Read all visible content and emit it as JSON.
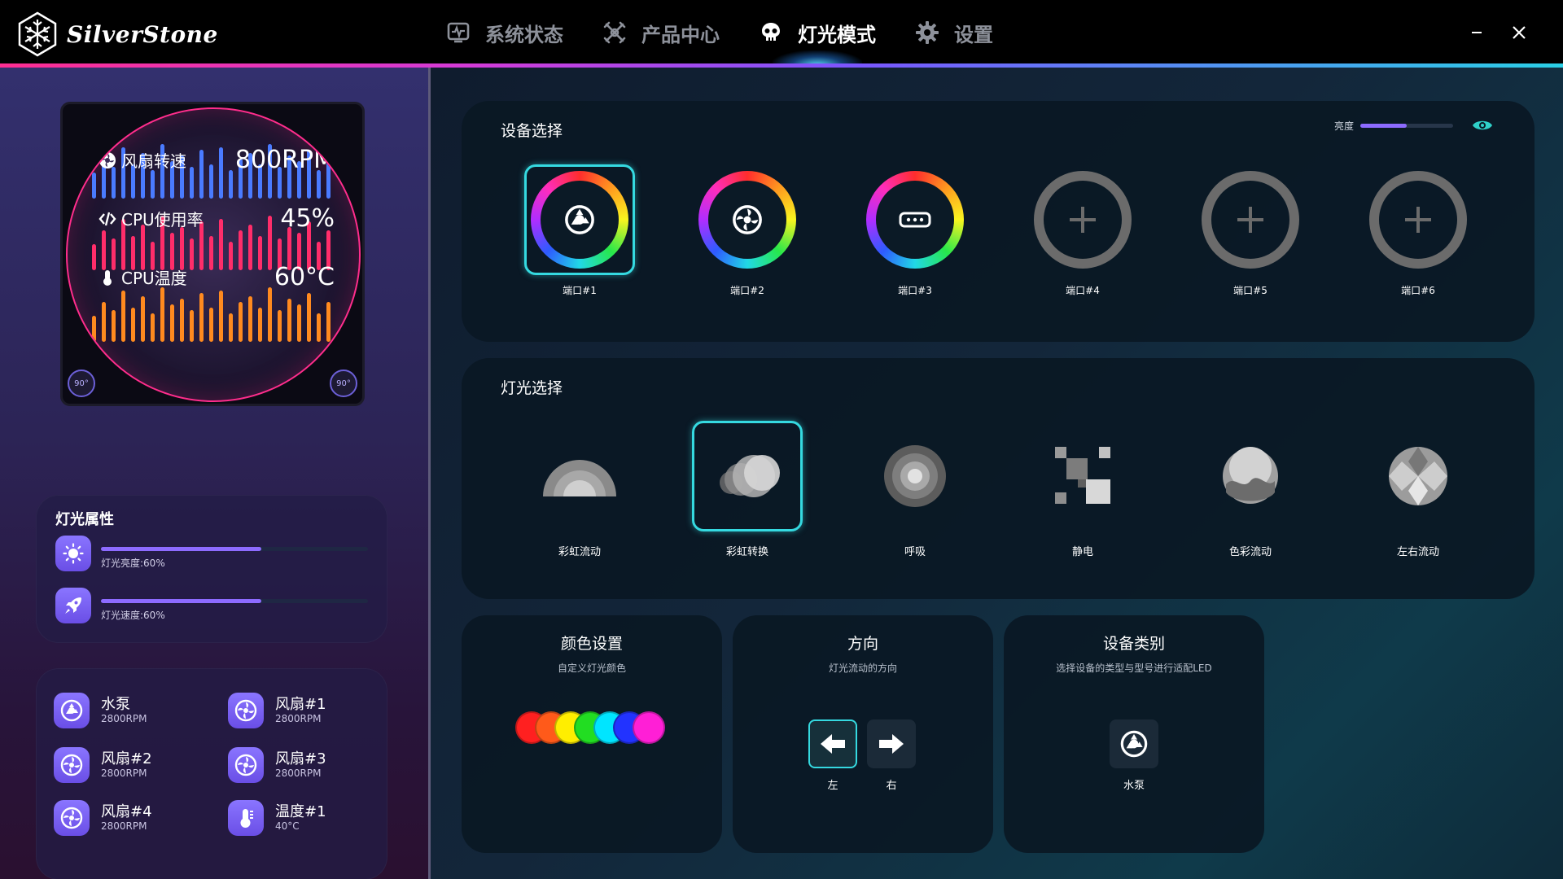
{
  "app": {
    "logo_text": "SilverStone"
  },
  "nav": {
    "tabs": [
      {
        "label": "系统状态",
        "icon": "monitor-icon",
        "active": false
      },
      {
        "label": "产品中心",
        "icon": "fan-crossed-icon",
        "active": false
      },
      {
        "label": "灯光模式",
        "icon": "skull-icon",
        "active": true
      },
      {
        "label": "设置",
        "icon": "gear-icon",
        "active": false
      }
    ]
  },
  "lcd": {
    "rows": [
      {
        "label": "风扇转速",
        "value": "800RPM",
        "icon": "fan-icon"
      },
      {
        "label": "CPU使用率",
        "value": "45%",
        "icon": "code-icon"
      },
      {
        "label": "CPU温度",
        "value": "60°C",
        "icon": "thermometer-icon"
      }
    ],
    "rotate_left": "90°",
    "rotate_right": "90°",
    "colors": {
      "blue": "#4a7bff",
      "red": "#ff2d6a",
      "orange": "#ff8a1f"
    }
  },
  "light_props": {
    "title": "灯光属性",
    "brightness": {
      "caption": "灯光亮度:60%",
      "level": 0.6,
      "icon": "sun-icon"
    },
    "speed": {
      "caption": "灯光速度:60%",
      "level": 0.6,
      "icon": "rocket-icon"
    }
  },
  "devices": [
    {
      "name": "水泵",
      "sub": "2800RPM",
      "icon": "pump-icon"
    },
    {
      "name": "风扇#1",
      "sub": "2800RPM",
      "icon": "fan-icon"
    },
    {
      "name": "风扇#2",
      "sub": "2800RPM",
      "icon": "fan-icon"
    },
    {
      "name": "风扇#3",
      "sub": "2800RPM",
      "icon": "fan-icon"
    },
    {
      "name": "风扇#4",
      "sub": "2800RPM",
      "icon": "fan-icon"
    },
    {
      "name": "温度#1",
      "sub": "40°C",
      "icon": "thermometer-icon"
    }
  ],
  "add_button": "+",
  "device_select": {
    "title": "设备选择",
    "brightness_label": "亮度",
    "brightness_level": 0.5,
    "ports": [
      {
        "label": "端口#1",
        "kind": "pump",
        "selected": true
      },
      {
        "label": "端口#2",
        "kind": "fan",
        "selected": false
      },
      {
        "label": "端口#3",
        "kind": "controller",
        "selected": false
      },
      {
        "label": "端口#4",
        "kind": "empty",
        "selected": false
      },
      {
        "label": "端口#5",
        "kind": "empty",
        "selected": false
      },
      {
        "label": "端口#6",
        "kind": "empty",
        "selected": false
      }
    ]
  },
  "light_select": {
    "title": "灯光选择",
    "effects": [
      {
        "label": "彩虹流动",
        "icon": "rainbow-flow-icon",
        "selected": false
      },
      {
        "label": "彩虹转换",
        "icon": "rainbow-shift-icon",
        "selected": true
      },
      {
        "label": "呼吸",
        "icon": "breathing-icon",
        "selected": false
      },
      {
        "label": "静电",
        "icon": "static-icon",
        "selected": false
      },
      {
        "label": "色彩流动",
        "icon": "color-flow-icon",
        "selected": false
      },
      {
        "label": "左右流动",
        "icon": "side-flow-icon",
        "selected": false
      }
    ]
  },
  "color_settings": {
    "title": "颜色设置",
    "subtitle": "自定义灯光颜色",
    "swatches": [
      "#ff2020",
      "#ff5a1a",
      "#ffee00",
      "#22dd22",
      "#00e5ff",
      "#2233ff",
      "#ff1fd6"
    ]
  },
  "direction": {
    "title": "方向",
    "subtitle": "灯光流动的方向",
    "left_label": "左",
    "right_label": "右",
    "selected": "left"
  },
  "device_type": {
    "title": "设备类别",
    "subtitle": "选择设备的类型与型号进行适配LED",
    "item_label": "水泵"
  }
}
